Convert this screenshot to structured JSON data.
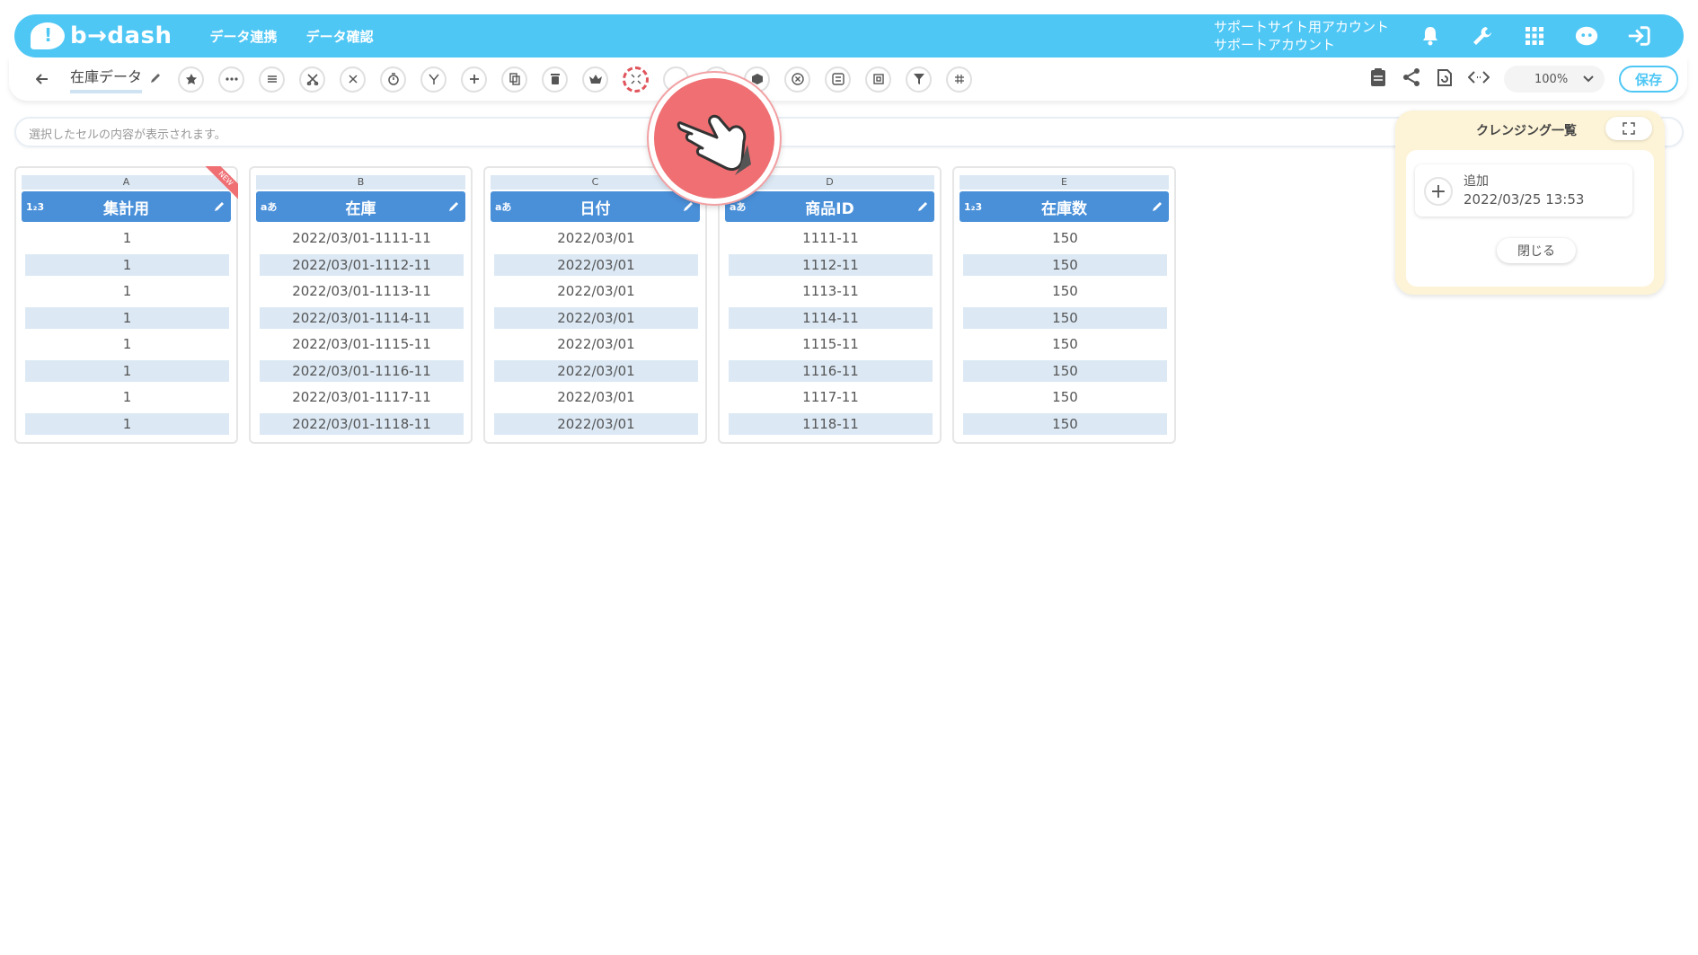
{
  "brand": {
    "name": "b→dash"
  },
  "topnav": [
    {
      "label": "データ連携"
    },
    {
      "label": "データ確認"
    }
  ],
  "account": {
    "line1": "サポートサイト用アカウント",
    "line2": "サポートアカウント"
  },
  "top_icons": [
    "bell-icon",
    "wrench-icon",
    "apps-grid-icon",
    "mascot-icon",
    "logout-icon"
  ],
  "sheet": {
    "back_label": "←",
    "name": "在庫データ"
  },
  "toolbar_icons": [
    "star-icon",
    "more-icon",
    "list-icon",
    "cut-icon",
    "cross-adjust-icon",
    "timer-icon",
    "merge-icon",
    "plus-icon",
    "copy-icon",
    "trash-icon",
    "crown-icon",
    "shrink-icon",
    "hidden-1-icon",
    "hidden-2-icon",
    "cube-icon",
    "close-circle-icon",
    "swap-icon",
    "box-icon",
    "filter-icon",
    "grid-icon"
  ],
  "right_tools": {
    "zoom": "100%",
    "save_label": "保存"
  },
  "cellbar": {
    "placeholder": "選択したセルの内容が表示されます。"
  },
  "table": {
    "columns": [
      {
        "letter": "A",
        "type": "1₂3",
        "title": "集計用",
        "new": true,
        "rows": [
          "1",
          "1",
          "1",
          "1",
          "1",
          "1",
          "1",
          "1"
        ]
      },
      {
        "letter": "B",
        "type": "aあ",
        "title": "在庫",
        "rows": [
          "2022/03/01-1111-11",
          "2022/03/01-1112-11",
          "2022/03/01-1113-11",
          "2022/03/01-1114-11",
          "2022/03/01-1115-11",
          "2022/03/01-1116-11",
          "2022/03/01-1117-11",
          "2022/03/01-1118-11"
        ]
      },
      {
        "letter": "C",
        "type": "aあ",
        "title": "日付",
        "rows": [
          "2022/03/01",
          "2022/03/01",
          "2022/03/01",
          "2022/03/01",
          "2022/03/01",
          "2022/03/01",
          "2022/03/01",
          "2022/03/01"
        ]
      },
      {
        "letter": "D",
        "type": "aあ",
        "title": "商品ID",
        "rows": [
          "1111-11",
          "1112-11",
          "1113-11",
          "1114-11",
          "1115-11",
          "1116-11",
          "1117-11",
          "1118-11"
        ]
      },
      {
        "letter": "E",
        "type": "1₂3",
        "title": "在庫数",
        "rows": [
          "150",
          "150",
          "150",
          "150",
          "150",
          "150",
          "150",
          "150"
        ]
      }
    ],
    "new_badge": "NEW"
  },
  "cleansing": {
    "title": "クレンジング一覧",
    "items": [
      {
        "label": "追加",
        "date": "2022/03/25 13:53"
      }
    ],
    "close_label": "閉じる"
  },
  "colors": {
    "primary": "#4fc7f5",
    "header_blue": "#4a90d9",
    "row_stripe": "#dce9f5",
    "pointer": "#ef6f73",
    "panel_bg": "#fdf3d6"
  }
}
